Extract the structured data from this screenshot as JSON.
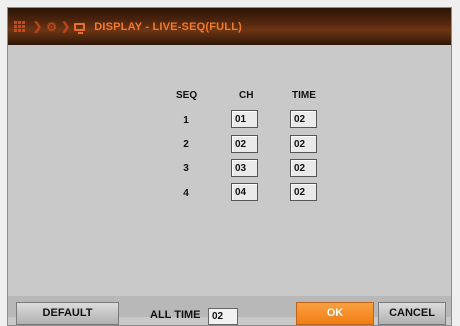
{
  "header": {
    "title": "DISPLAY - LIVE-SEQ(FULL)",
    "breadcrumb_icons": [
      "grid-menu-icon",
      "gear-icon",
      "monitor-icon"
    ],
    "accent_color": "#f27b2a"
  },
  "table": {
    "headers": {
      "seq": "SEQ",
      "ch": "CH",
      "time": "TIME"
    },
    "rows": [
      {
        "seq": "1",
        "ch": "01",
        "time": "02"
      },
      {
        "seq": "2",
        "ch": "02",
        "time": "02"
      },
      {
        "seq": "3",
        "ch": "03",
        "time": "02"
      },
      {
        "seq": "4",
        "ch": "04",
        "time": "02"
      }
    ]
  },
  "footer": {
    "default_label": "DEFAULT",
    "alltime_label": "ALL TIME",
    "alltime_value": "02",
    "ok_label": "OK",
    "cancel_label": "CANCEL"
  }
}
